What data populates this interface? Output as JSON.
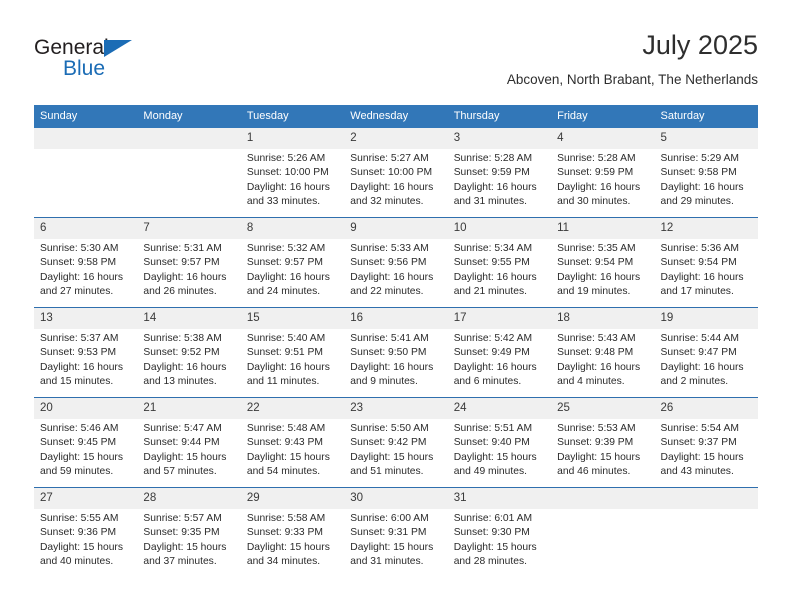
{
  "brand": {
    "name_dark": "General",
    "name_blue": "Blue",
    "accent_color": "#1b6cb5"
  },
  "header": {
    "title": "July 2025",
    "subtitle": "Abcoven, North Brabant, The Netherlands"
  },
  "calendar": {
    "header_bg": "#3277b8",
    "row_divider_color": "#2f6fae",
    "daynum_bg": "#f0f0f0",
    "weekdays": [
      "Sunday",
      "Monday",
      "Tuesday",
      "Wednesday",
      "Thursday",
      "Friday",
      "Saturday"
    ],
    "weeks": [
      [
        {
          "day": "",
          "empty": true
        },
        {
          "day": "",
          "empty": true
        },
        {
          "day": "1",
          "sunrise": "Sunrise: 5:26 AM",
          "sunset": "Sunset: 10:00 PM",
          "daylight_line1": "Daylight: 16 hours",
          "daylight_line2": "and 33 minutes."
        },
        {
          "day": "2",
          "sunrise": "Sunrise: 5:27 AM",
          "sunset": "Sunset: 10:00 PM",
          "daylight_line1": "Daylight: 16 hours",
          "daylight_line2": "and 32 minutes."
        },
        {
          "day": "3",
          "sunrise": "Sunrise: 5:28 AM",
          "sunset": "Sunset: 9:59 PM",
          "daylight_line1": "Daylight: 16 hours",
          "daylight_line2": "and 31 minutes."
        },
        {
          "day": "4",
          "sunrise": "Sunrise: 5:28 AM",
          "sunset": "Sunset: 9:59 PM",
          "daylight_line1": "Daylight: 16 hours",
          "daylight_line2": "and 30 minutes."
        },
        {
          "day": "5",
          "sunrise": "Sunrise: 5:29 AM",
          "sunset": "Sunset: 9:58 PM",
          "daylight_line1": "Daylight: 16 hours",
          "daylight_line2": "and 29 minutes."
        }
      ],
      [
        {
          "day": "6",
          "sunrise": "Sunrise: 5:30 AM",
          "sunset": "Sunset: 9:58 PM",
          "daylight_line1": "Daylight: 16 hours",
          "daylight_line2": "and 27 minutes."
        },
        {
          "day": "7",
          "sunrise": "Sunrise: 5:31 AM",
          "sunset": "Sunset: 9:57 PM",
          "daylight_line1": "Daylight: 16 hours",
          "daylight_line2": "and 26 minutes."
        },
        {
          "day": "8",
          "sunrise": "Sunrise: 5:32 AM",
          "sunset": "Sunset: 9:57 PM",
          "daylight_line1": "Daylight: 16 hours",
          "daylight_line2": "and 24 minutes."
        },
        {
          "day": "9",
          "sunrise": "Sunrise: 5:33 AM",
          "sunset": "Sunset: 9:56 PM",
          "daylight_line1": "Daylight: 16 hours",
          "daylight_line2": "and 22 minutes."
        },
        {
          "day": "10",
          "sunrise": "Sunrise: 5:34 AM",
          "sunset": "Sunset: 9:55 PM",
          "daylight_line1": "Daylight: 16 hours",
          "daylight_line2": "and 21 minutes."
        },
        {
          "day": "11",
          "sunrise": "Sunrise: 5:35 AM",
          "sunset": "Sunset: 9:54 PM",
          "daylight_line1": "Daylight: 16 hours",
          "daylight_line2": "and 19 minutes."
        },
        {
          "day": "12",
          "sunrise": "Sunrise: 5:36 AM",
          "sunset": "Sunset: 9:54 PM",
          "daylight_line1": "Daylight: 16 hours",
          "daylight_line2": "and 17 minutes."
        }
      ],
      [
        {
          "day": "13",
          "sunrise": "Sunrise: 5:37 AM",
          "sunset": "Sunset: 9:53 PM",
          "daylight_line1": "Daylight: 16 hours",
          "daylight_line2": "and 15 minutes."
        },
        {
          "day": "14",
          "sunrise": "Sunrise: 5:38 AM",
          "sunset": "Sunset: 9:52 PM",
          "daylight_line1": "Daylight: 16 hours",
          "daylight_line2": "and 13 minutes."
        },
        {
          "day": "15",
          "sunrise": "Sunrise: 5:40 AM",
          "sunset": "Sunset: 9:51 PM",
          "daylight_line1": "Daylight: 16 hours",
          "daylight_line2": "and 11 minutes."
        },
        {
          "day": "16",
          "sunrise": "Sunrise: 5:41 AM",
          "sunset": "Sunset: 9:50 PM",
          "daylight_line1": "Daylight: 16 hours",
          "daylight_line2": "and 9 minutes."
        },
        {
          "day": "17",
          "sunrise": "Sunrise: 5:42 AM",
          "sunset": "Sunset: 9:49 PM",
          "daylight_line1": "Daylight: 16 hours",
          "daylight_line2": "and 6 minutes."
        },
        {
          "day": "18",
          "sunrise": "Sunrise: 5:43 AM",
          "sunset": "Sunset: 9:48 PM",
          "daylight_line1": "Daylight: 16 hours",
          "daylight_line2": "and 4 minutes."
        },
        {
          "day": "19",
          "sunrise": "Sunrise: 5:44 AM",
          "sunset": "Sunset: 9:47 PM",
          "daylight_line1": "Daylight: 16 hours",
          "daylight_line2": "and 2 minutes."
        }
      ],
      [
        {
          "day": "20",
          "sunrise": "Sunrise: 5:46 AM",
          "sunset": "Sunset: 9:45 PM",
          "daylight_line1": "Daylight: 15 hours",
          "daylight_line2": "and 59 minutes."
        },
        {
          "day": "21",
          "sunrise": "Sunrise: 5:47 AM",
          "sunset": "Sunset: 9:44 PM",
          "daylight_line1": "Daylight: 15 hours",
          "daylight_line2": "and 57 minutes."
        },
        {
          "day": "22",
          "sunrise": "Sunrise: 5:48 AM",
          "sunset": "Sunset: 9:43 PM",
          "daylight_line1": "Daylight: 15 hours",
          "daylight_line2": "and 54 minutes."
        },
        {
          "day": "23",
          "sunrise": "Sunrise: 5:50 AM",
          "sunset": "Sunset: 9:42 PM",
          "daylight_line1": "Daylight: 15 hours",
          "daylight_line2": "and 51 minutes."
        },
        {
          "day": "24",
          "sunrise": "Sunrise: 5:51 AM",
          "sunset": "Sunset: 9:40 PM",
          "daylight_line1": "Daylight: 15 hours",
          "daylight_line2": "and 49 minutes."
        },
        {
          "day": "25",
          "sunrise": "Sunrise: 5:53 AM",
          "sunset": "Sunset: 9:39 PM",
          "daylight_line1": "Daylight: 15 hours",
          "daylight_line2": "and 46 minutes."
        },
        {
          "day": "26",
          "sunrise": "Sunrise: 5:54 AM",
          "sunset": "Sunset: 9:37 PM",
          "daylight_line1": "Daylight: 15 hours",
          "daylight_line2": "and 43 minutes."
        }
      ],
      [
        {
          "day": "27",
          "sunrise": "Sunrise: 5:55 AM",
          "sunset": "Sunset: 9:36 PM",
          "daylight_line1": "Daylight: 15 hours",
          "daylight_line2": "and 40 minutes."
        },
        {
          "day": "28",
          "sunrise": "Sunrise: 5:57 AM",
          "sunset": "Sunset: 9:35 PM",
          "daylight_line1": "Daylight: 15 hours",
          "daylight_line2": "and 37 minutes."
        },
        {
          "day": "29",
          "sunrise": "Sunrise: 5:58 AM",
          "sunset": "Sunset: 9:33 PM",
          "daylight_line1": "Daylight: 15 hours",
          "daylight_line2": "and 34 minutes."
        },
        {
          "day": "30",
          "sunrise": "Sunrise: 6:00 AM",
          "sunset": "Sunset: 9:31 PM",
          "daylight_line1": "Daylight: 15 hours",
          "daylight_line2": "and 31 minutes."
        },
        {
          "day": "31",
          "sunrise": "Sunrise: 6:01 AM",
          "sunset": "Sunset: 9:30 PM",
          "daylight_line1": "Daylight: 15 hours",
          "daylight_line2": "and 28 minutes."
        },
        {
          "day": "",
          "empty": true
        },
        {
          "day": "",
          "empty": true
        }
      ]
    ]
  }
}
